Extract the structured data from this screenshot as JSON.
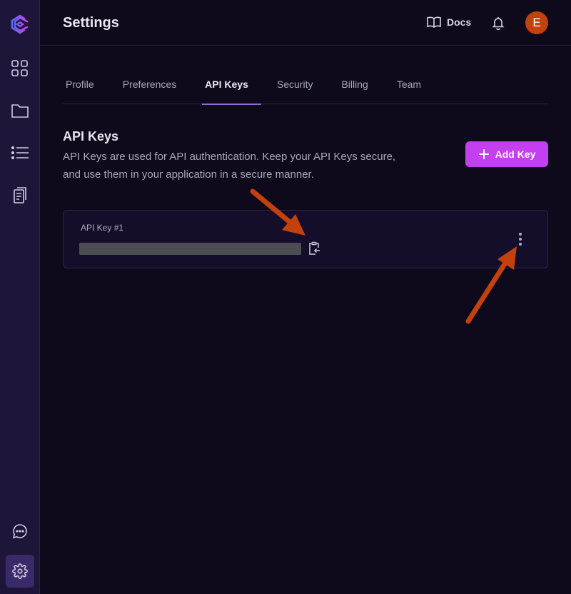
{
  "header": {
    "title": "Settings",
    "docs_label": "Docs",
    "avatar_initial": "E"
  },
  "sidebar": {
    "items": [
      {
        "icon": "logo-icon"
      },
      {
        "icon": "dashboard-grid-icon"
      },
      {
        "icon": "folder-icon"
      },
      {
        "icon": "list-icon"
      },
      {
        "icon": "documents-icon"
      },
      {
        "icon": "chat-icon"
      },
      {
        "icon": "gear-icon",
        "active": true
      }
    ]
  },
  "tabs": [
    {
      "label": "Profile"
    },
    {
      "label": "Preferences"
    },
    {
      "label": "API Keys",
      "active": true
    },
    {
      "label": "Security"
    },
    {
      "label": "Billing"
    },
    {
      "label": "Team"
    }
  ],
  "section": {
    "title": "API Keys",
    "description": "API Keys are used for API authentication. Keep your API Keys secure, and use them in your application in a secure manner.",
    "add_button": "Add Key"
  },
  "keys": [
    {
      "label": "API Key #1",
      "value_masked": true
    }
  ],
  "colors": {
    "accent": "#c43ff0",
    "avatar": "#c2410c",
    "annotation_arrow": "#c2410c"
  }
}
